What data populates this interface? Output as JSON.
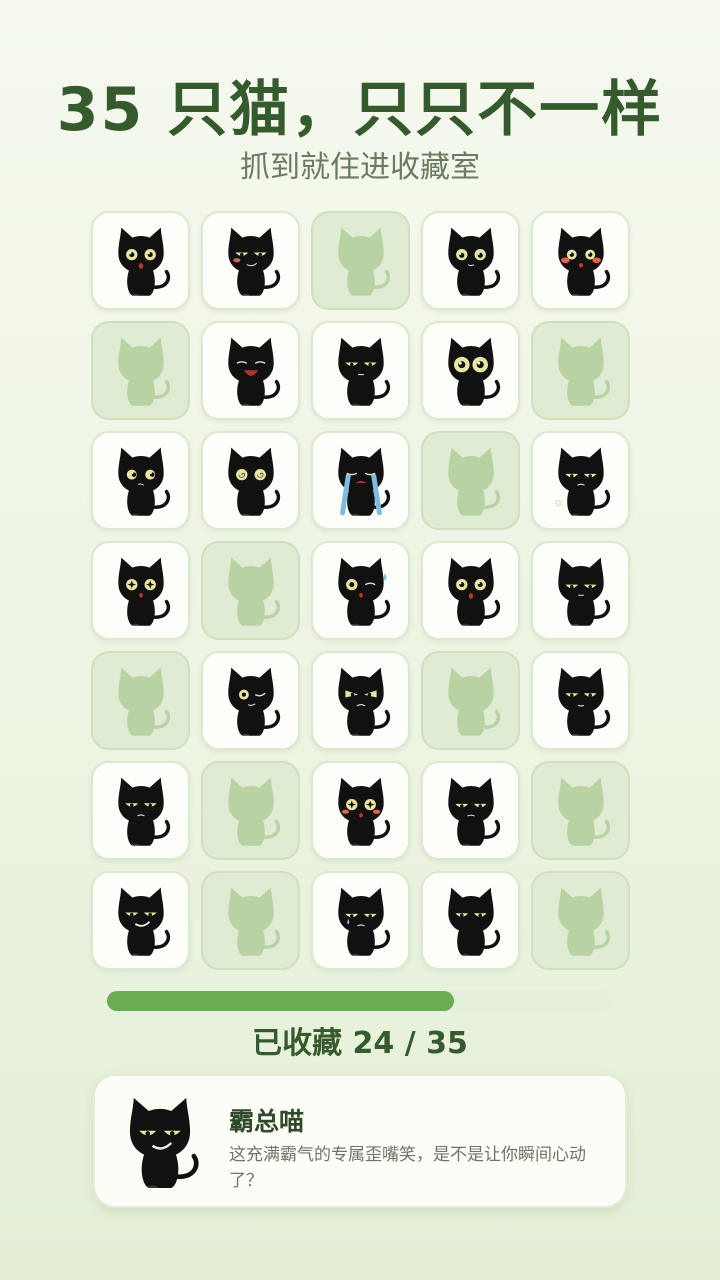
{
  "header": {
    "title": "35 只猫，只只不一样",
    "subtitle": "抓到就住进收藏室"
  },
  "grid": {
    "tiles": [
      {
        "unlocked": true,
        "expression": "surprised"
      },
      {
        "unlocked": true,
        "expression": "smirk-blush"
      },
      {
        "unlocked": false,
        "expression": "locked"
      },
      {
        "unlocked": true,
        "expression": "wide-eyed"
      },
      {
        "unlocked": true,
        "expression": "blush"
      },
      {
        "unlocked": false,
        "expression": "locked"
      },
      {
        "unlocked": true,
        "expression": "crying-loud"
      },
      {
        "unlocked": true,
        "expression": "side-eye"
      },
      {
        "unlocked": true,
        "expression": "big-eyes"
      },
      {
        "unlocked": false,
        "expression": "locked"
      },
      {
        "unlocked": true,
        "expression": "confused"
      },
      {
        "unlocked": true,
        "expression": "dizzy"
      },
      {
        "unlocked": true,
        "expression": "tears"
      },
      {
        "unlocked": false,
        "expression": "locked"
      },
      {
        "unlocked": true,
        "expression": "sigh"
      },
      {
        "unlocked": true,
        "expression": "starry"
      },
      {
        "unlocked": false,
        "expression": "locked"
      },
      {
        "unlocked": true,
        "expression": "wink-sweat"
      },
      {
        "unlocked": true,
        "expression": "shocked"
      },
      {
        "unlocked": true,
        "expression": "sleepy"
      },
      {
        "unlocked": false,
        "expression": "locked"
      },
      {
        "unlocked": true,
        "expression": "one-eye"
      },
      {
        "unlocked": true,
        "expression": "angry"
      },
      {
        "unlocked": false,
        "expression": "locked"
      },
      {
        "unlocked": true,
        "expression": "squint"
      },
      {
        "unlocked": true,
        "expression": "grumpy"
      },
      {
        "unlocked": false,
        "expression": "locked"
      },
      {
        "unlocked": true,
        "expression": "starry-blush"
      },
      {
        "unlocked": true,
        "expression": "unimpressed"
      },
      {
        "unlocked": false,
        "expression": "locked"
      },
      {
        "unlocked": true,
        "expression": "smug-grin"
      },
      {
        "unlocked": false,
        "expression": "locked"
      },
      {
        "unlocked": true,
        "expression": "teary"
      },
      {
        "unlocked": true,
        "expression": "sitting"
      },
      {
        "unlocked": false,
        "expression": "locked"
      }
    ]
  },
  "progress": {
    "label": "已收藏 24 / 35",
    "collected": 24,
    "total": 35,
    "fill_fraction": 0.6857
  },
  "featured": {
    "name": "霸总喵",
    "description": "这充满霸气的专属歪嘴笑，是不是让你瞬间心动了？",
    "expression": "smug-grin"
  },
  "colors": {
    "title": "#355a2e",
    "progress_fill": "#6aad55",
    "locked_tile": "#dfebd2",
    "locked_silhouette": "#b9d2a4",
    "cat_body": "#111111",
    "cat_eye": "#e8e6a0"
  }
}
